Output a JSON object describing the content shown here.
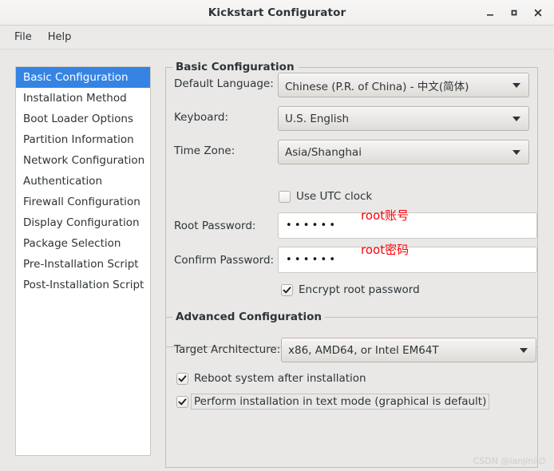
{
  "window": {
    "title": "Kickstart Configurator",
    "controls": {
      "minimize": "minimize-icon",
      "maximize": "maximize-icon",
      "close": "close-icon"
    }
  },
  "menubar": {
    "items": [
      {
        "label": "File"
      },
      {
        "label": "Help"
      }
    ]
  },
  "sidebar": {
    "selected_index": 0,
    "items": [
      {
        "label": "Basic Configuration"
      },
      {
        "label": "Installation Method"
      },
      {
        "label": "Boot Loader Options"
      },
      {
        "label": "Partition Information"
      },
      {
        "label": "Network Configuration"
      },
      {
        "label": "Authentication"
      },
      {
        "label": "Firewall Configuration"
      },
      {
        "label": "Display Configuration"
      },
      {
        "label": "Package Selection"
      },
      {
        "label": "Pre-Installation Script"
      },
      {
        "label": "Post-Installation Script"
      }
    ]
  },
  "basic_configuration": {
    "group_title": "Basic Configuration",
    "default_language": {
      "label": "Default Language:",
      "value": "Chinese (P.R. of China) - 中文(简体)"
    },
    "keyboard": {
      "label": "Keyboard:",
      "value": "U.S. English"
    },
    "time_zone": {
      "label": "Time Zone:",
      "value": "Asia/Shanghai"
    },
    "use_utc_clock": {
      "label": "Use UTC clock",
      "checked": false
    },
    "root_password": {
      "label": "Root Password:",
      "value": "••••••"
    },
    "confirm_password": {
      "label": "Confirm Password:",
      "value": "••••••"
    },
    "encrypt_root_password": {
      "label": "Encrypt root password",
      "checked": true
    }
  },
  "advanced_configuration": {
    "group_title": "Advanced Configuration",
    "target_architecture": {
      "label": "Target Architecture:",
      "value": "x86, AMD64, or Intel EM64T"
    },
    "reboot_after_install": {
      "label": "Reboot system after installation",
      "checked": true
    },
    "text_mode_install": {
      "label": "Perform installation in text mode (graphical is default)",
      "checked": true
    }
  },
  "annotations": [
    {
      "text": "root账号"
    },
    {
      "text": "root密码"
    }
  ],
  "watermark": {
    "text": "CSDN @lanjinli∅"
  },
  "colors": {
    "accent": "#3584e4",
    "annotation": "#fb0007",
    "window_bg": "#e9e8e7",
    "text": "#2e3436"
  }
}
